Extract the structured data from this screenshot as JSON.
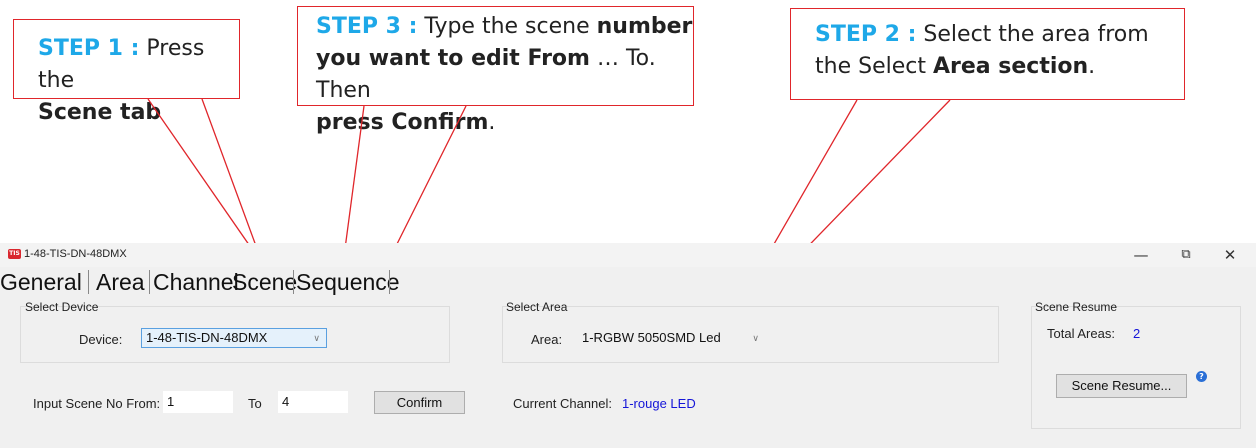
{
  "callouts": {
    "step1": {
      "step": "STEP 1 :",
      "text1": " Press the",
      "bold1": "Scene tab"
    },
    "step3": {
      "step": "STEP 3 :",
      "text1": " Type the scene ",
      "bold1": "number",
      "bold2": "you want to edit From",
      "text2": " … To. Then",
      "bold3": "press Confirm",
      "text3": "."
    },
    "step2": {
      "step": "STEP 2 :",
      "text1": " Select the area from",
      "text2": "the Select ",
      "bold1": "Area section",
      "text3": "."
    }
  },
  "window": {
    "title": "1-48-TIS-DN-48DMX",
    "icon_text": "TIS"
  },
  "window_controls": {
    "minimize": "—",
    "restore": "⧉",
    "close": "✕"
  },
  "tabs": [
    "General",
    "Area",
    "Channel",
    "Scene",
    "Sequence"
  ],
  "select_device": {
    "group_label": "Select Device",
    "device_label": "Device:",
    "device_value": "1-48-TIS-DN-48DMX"
  },
  "select_area": {
    "group_label": "Select Area",
    "area_label": "Area:",
    "area_value": "1-RGBW 5050SMD Led"
  },
  "scene_resume": {
    "group_label": "Scene Resume",
    "total_areas_label": "Total Areas:",
    "total_areas_value": "2",
    "button_label": "Scene Resume...",
    "help_icon": "?"
  },
  "scene_input": {
    "from_label": "Input Scene No From:",
    "from_value": "1",
    "to_label": "To",
    "to_value": "4",
    "confirm_label": "Confirm"
  },
  "current_channel": {
    "label": "Current Channel:",
    "value": "1-rouge LED"
  },
  "colors": {
    "callout_border": "#e0262b",
    "step_blue": "#1ea8e8",
    "value_blue": "#1515d8"
  }
}
